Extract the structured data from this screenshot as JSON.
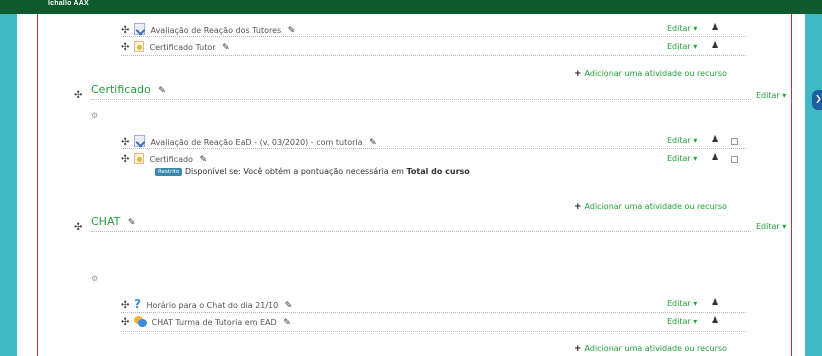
{
  "header": {
    "title": "Ichallo AAX"
  },
  "labels": {
    "edit": "Editar",
    "add_activity": "Adicionar uma atividade ou recurso",
    "restricted_badge": "Restrito"
  },
  "top_items": [
    {
      "name": "Avaliação de Reação dos Tutores",
      "icon": "quiz-icon"
    },
    {
      "name": "Certificado Tutor",
      "icon": "certificate-icon"
    }
  ],
  "sections": {
    "certificado": {
      "title": "Certificado",
      "items": [
        {
          "name": "Avaliação de Reação EaD - (v. 03/2020) - com tutoria",
          "icon": "quiz-icon"
        },
        {
          "name": "Certificado",
          "icon": "certificate-icon",
          "restriction_prefix": "Disponível se: Você obtém a pontuação necessária em",
          "restriction_bold": "Total do curso"
        }
      ]
    },
    "chat": {
      "title": "CHAT",
      "items": [
        {
          "name": "Horário para o Chat do dia 21/10",
          "icon": "help-icon"
        },
        {
          "name": "CHAT Turma de Tutoria em EAD",
          "icon": "chat-icon"
        }
      ]
    }
  },
  "colors": {
    "accent_green": "#23a139",
    "frame_red": "#c8323a",
    "topbar": "#0f5a2e",
    "background": "#3fb9c3"
  }
}
